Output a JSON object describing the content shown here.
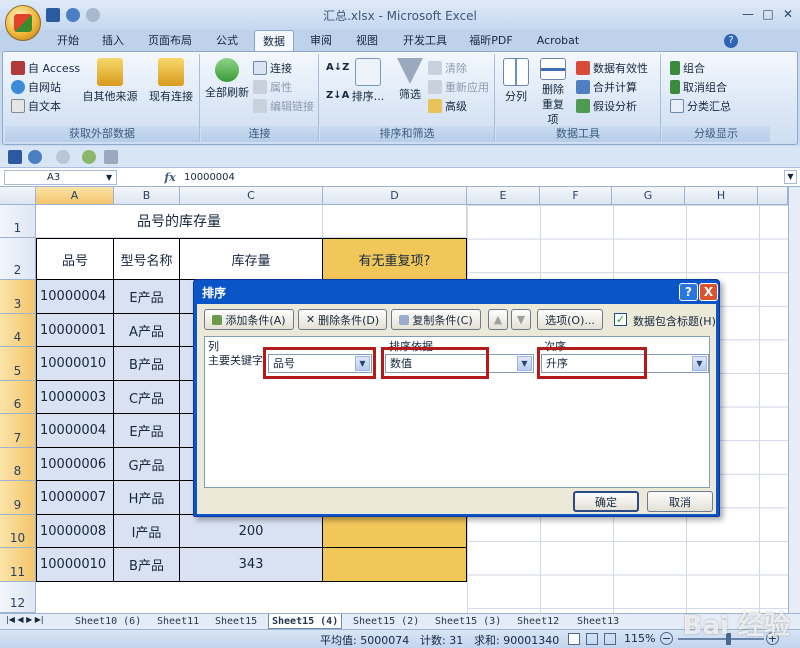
{
  "window": {
    "title": "汇总.xlsx - Microsoft Excel"
  },
  "ribbon_tabs": [
    "开始",
    "插入",
    "页面布局",
    "公式",
    "数据",
    "审阅",
    "视图",
    "开发工具",
    "福昕PDF",
    "Acrobat"
  ],
  "ribbon": {
    "group_external": {
      "label": "获取外部数据",
      "access": "自 Access",
      "web": "自网站",
      "text": "自文本",
      "other": "自其他来源",
      "existing": "现有连接"
    },
    "group_connections": {
      "label": "连接",
      "refresh": "全部刷新",
      "connections": "连接",
      "properties": "属性",
      "edit_links": "编辑链接"
    },
    "group_sort": {
      "label": "排序和筛选",
      "sort": "排序...",
      "filter": "筛选",
      "clear": "清除",
      "reapply": "重新应用",
      "advanced": "高级"
    },
    "group_tools": {
      "label": "数据工具",
      "split": "分列",
      "remove_dup": "删除重复项",
      "validation": "数据有效性",
      "consolidate": "合并计算",
      "whatif": "假设分析"
    },
    "group_outline": {
      "label": "分级显示",
      "group": "组合",
      "ungroup": "取消组合",
      "subtotal": "分类汇总"
    }
  },
  "formula_bar": {
    "name_box": "A3",
    "fx": "fx",
    "value": "10000004"
  },
  "columns": [
    "A",
    "B",
    "C",
    "D",
    "E",
    "F",
    "G",
    "H"
  ],
  "rows": [
    "1",
    "2",
    "3",
    "4",
    "5",
    "6",
    "7",
    "8",
    "9",
    "10",
    "11",
    "12"
  ],
  "sheet": {
    "title": "品号的库存量",
    "headers": [
      "品号",
      "型号名称",
      "库存量",
      "有无重复项?"
    ],
    "data": [
      [
        "10000004",
        "E产品",
        ""
      ],
      [
        "10000001",
        "A产品",
        ""
      ],
      [
        "10000010",
        "B产品",
        ""
      ],
      [
        "10000003",
        "C产品",
        ""
      ],
      [
        "10000004",
        "E产品",
        ""
      ],
      [
        "10000006",
        "G产品",
        ""
      ],
      [
        "10000007",
        "H产品",
        ""
      ],
      [
        "10000008",
        "I产品",
        "200"
      ],
      [
        "10000010",
        "B产品",
        "343"
      ]
    ]
  },
  "sheet_tabs": [
    "Sheet10 (6)",
    "Sheet11",
    "Sheet15",
    "Sheet15 (4)",
    "Sheet15 (2)",
    "Sheet15 (3)",
    "Sheet12",
    "Sheet13"
  ],
  "active_sheet": "Sheet15 (4)",
  "status": {
    "average": "平均值: 5000074",
    "count": "计数: 31",
    "sum": "求和: 90001340",
    "zoom": "115%"
  },
  "dialog": {
    "title": "排序",
    "help": "?",
    "close": "X",
    "add": "添加条件(A)",
    "delete": "删除条件(D)",
    "copy": "复制条件(C)",
    "options": "选项(O)...",
    "has_header": "数据包含标题(H)",
    "col_header": "列",
    "sort_on_header": "排序依据",
    "order_header": "次序",
    "row_label": "主要关键字",
    "column_value": "品号",
    "sort_on_value": "数值",
    "order_value": "升序",
    "ok": "确定",
    "cancel": "取消"
  },
  "watermark": "Bai 经验",
  "colors": {
    "gold": "#f2c75a",
    "dialog_blue": "#0a56c8",
    "highlight_red": "#b31a1a"
  }
}
